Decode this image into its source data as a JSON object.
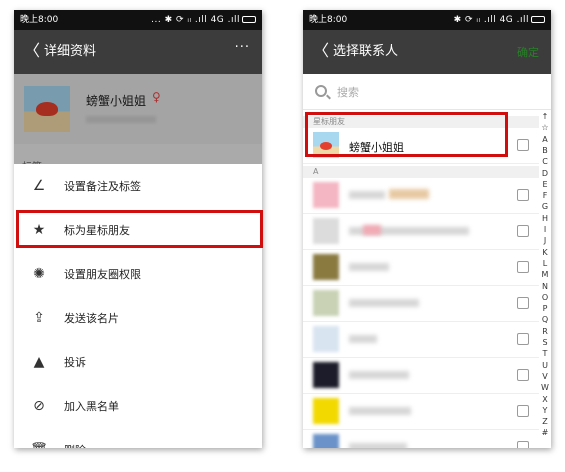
{
  "colors": {
    "highlight": "#d10e0e",
    "navbar": "#3c3c3c",
    "statusbar": "#111111",
    "finish": "#1aad19"
  },
  "left": {
    "status": {
      "time": "晚上8:00",
      "icons": "... ✱ ⟳ ᵢₗ .ıll 4G .ıll"
    },
    "nav": {
      "back": "〈",
      "title": "详细资料",
      "more": "···"
    },
    "profile": {
      "name": "螃蟹小姐姐",
      "gender_icon": "person-icon",
      "behind_label": "标签"
    },
    "menu": [
      {
        "label": "设置备注及标签",
        "icon": "pencil-icon",
        "glyph": "∠"
      },
      {
        "label": "标为星标朋友",
        "icon": "star-icon",
        "glyph": "★"
      },
      {
        "label": "设置朋友圈权限",
        "icon": "moments-icon",
        "glyph": "✺"
      },
      {
        "label": "发送该名片",
        "icon": "share-icon",
        "glyph": "⇪"
      },
      {
        "label": "投诉",
        "icon": "warning-icon",
        "glyph": "▲"
      },
      {
        "label": "加入黑名单",
        "icon": "block-icon",
        "glyph": "⊘"
      },
      {
        "label": "删除",
        "icon": "trash-icon",
        "glyph": "🗑"
      }
    ]
  },
  "right": {
    "status": {
      "time": "晚上8:00",
      "icons": "✱ ⟳ ᵢₗ .ıll 4G .ıll"
    },
    "nav": {
      "back": "〈",
      "title": "选择联系人",
      "finish": "确定"
    },
    "search": {
      "placeholder": "搜索"
    },
    "starred_header": "星标朋友",
    "a_header": "A",
    "starred_contact": "螃蟹小姐姐",
    "index": [
      "↑",
      "☆",
      "A",
      "B",
      "C",
      "D",
      "E",
      "F",
      "G",
      "H",
      "I",
      "J",
      "K",
      "L",
      "M",
      "N",
      "O",
      "P",
      "Q",
      "R",
      "S",
      "T",
      "U",
      "V",
      "W",
      "X",
      "Y",
      "Z",
      "#"
    ]
  }
}
